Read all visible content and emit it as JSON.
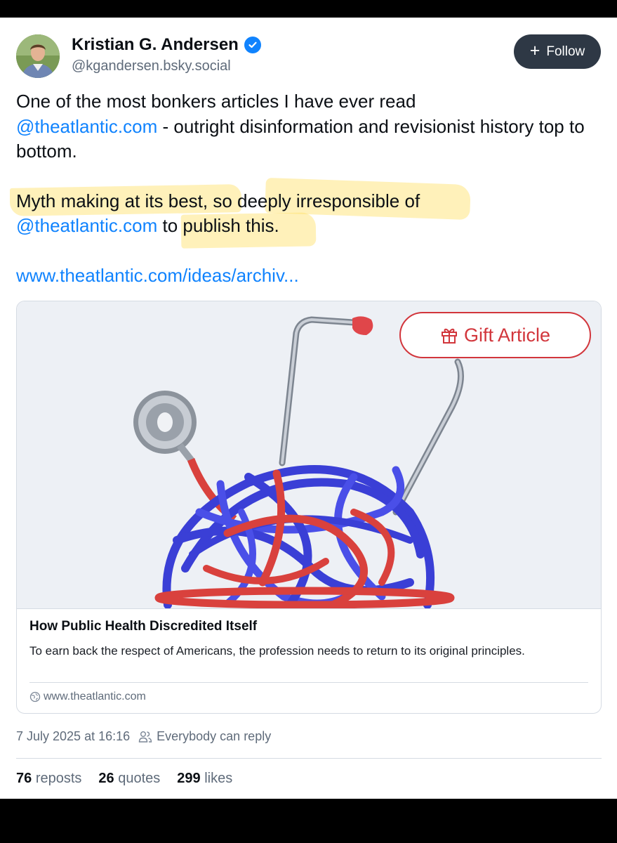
{
  "author": {
    "name": "Kristian G. Andersen",
    "handle": "@kgandersen.bsky.social",
    "verified": true
  },
  "follow_button": {
    "icon": "plus-icon",
    "label": "Follow"
  },
  "post": {
    "paragraph1": {
      "text_before": "One of the most bonkers articles I have ever read",
      "mention": "@theatlantic.com",
      "text_after": " - outright disinformation and revisionist history top to bottom."
    },
    "paragraph2": {
      "text_before": "Myth making at its best, so deeply irresponsible of",
      "mention": "@theatlantic.com",
      "text_after": " to publish this."
    },
    "link": "www.theatlantic.com/ideas/archiv..."
  },
  "link_card": {
    "image_description": "",
    "gift_button": {
      "icon": "gift-icon",
      "label": "Gift Article"
    },
    "title": "How Public Health Discredited Itself",
    "description": "To earn back the respect of Americans, the profession needs to return to its original principles.",
    "domain": "www.theatlantic.com",
    "domain_icon": "globe-icon"
  },
  "meta": {
    "timestamp": "7 July 2025 at 16:16",
    "reply_icon": "people-icon",
    "reply_setting": "Everybody can reply"
  },
  "stats": {
    "reposts_count": "76",
    "reposts_label": "reposts",
    "quotes_count": "26",
    "quotes_label": "quotes",
    "likes_count": "299",
    "likes_label": "likes"
  },
  "colors": {
    "accent": "#1083fe",
    "follow_bg": "#2e3845",
    "gift_red": "#d2363c",
    "highlight": "#ffdd5a"
  }
}
